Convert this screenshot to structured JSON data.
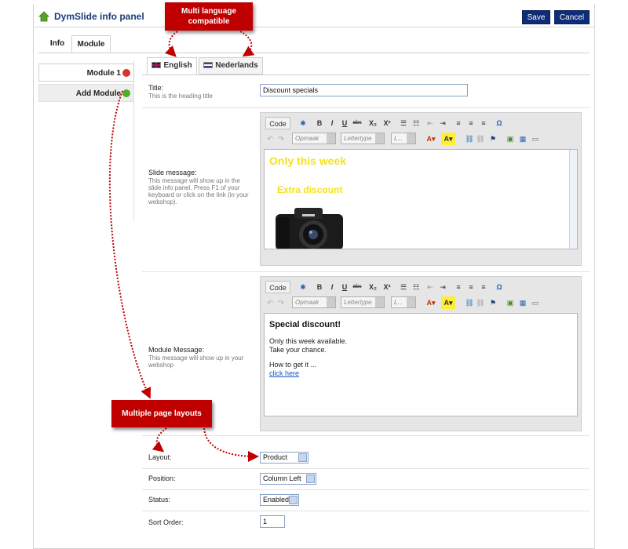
{
  "header": {
    "title": "DymSlide info panel",
    "save_label": "Save",
    "cancel_label": "Cancel"
  },
  "tabs": {
    "info": "Info",
    "module": "Module"
  },
  "sidebar": {
    "module1": "Module 1",
    "add": "Add Module"
  },
  "languages": {
    "english": "English",
    "dutch": "Nederlands"
  },
  "fields": {
    "title_label": "Title:",
    "title_hint": "This is the heading title",
    "title_value": "Discount specials",
    "slide_label": "Slide message:",
    "slide_hint": "This message will show up in the slide info panel. Press F1 of your keyboard or click on the link (in your webshop).",
    "module_label": "Module Message:",
    "module_hint": "This message will show up in your webshop",
    "layout_label": "Layout:",
    "layout_value": "Product",
    "position_label": "Position:",
    "position_value": "Column Left",
    "status_label": "Status:",
    "status_value": "Enabled",
    "sort_label": "Sort Order:",
    "sort_value": "1"
  },
  "toolbar": {
    "code": "Code",
    "bold": "B",
    "italic": "I",
    "underline": "U",
    "strike": "abc",
    "sub": "X₂",
    "sup": "X²",
    "format_combo": "Opmaak",
    "font_combo": "Lettertype",
    "size_combo": "L...",
    "omega": "Ω"
  },
  "slide_editor": {
    "heading": "Only this week",
    "sub": "Extra discount"
  },
  "module_editor": {
    "heading": "Special discount!",
    "line1": "Only this week available.",
    "line2": "Take your chance.",
    "line3": "How to get it ...",
    "link": "click here"
  },
  "callouts": {
    "multilang": "Multi language compatible",
    "layouts": "Multiple page layouts"
  },
  "colors": {
    "accent": "#0f2c78",
    "callout": "#c00000",
    "slide_text": "#f5e21c"
  }
}
